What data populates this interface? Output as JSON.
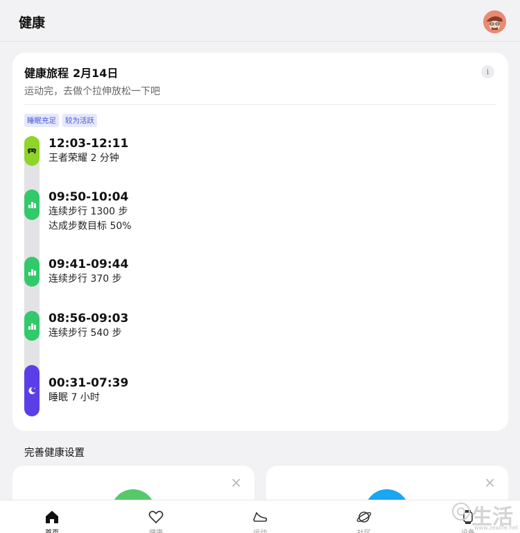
{
  "header": {
    "title": "健康",
    "avatar_icon": "user-avatar"
  },
  "journey": {
    "title": "健康旅程",
    "date": "2月14日",
    "subtitle": "运动完，去做个拉伸放松一下吧",
    "info_label": "i",
    "tags": [
      "睡眠充足",
      "较为活跃"
    ],
    "entries": [
      {
        "time": "12:03-12:11",
        "lines": [
          "王者荣耀 2 分钟"
        ],
        "icon": "gamepad-icon",
        "color": "#8ed42a"
      },
      {
        "time": "09:50-10:04",
        "lines": [
          "连续步行 1300 步",
          "达成步数目标 50%"
        ],
        "icon": "bar-chart-icon",
        "color": "#32c96b"
      },
      {
        "time": "09:41-09:44",
        "lines": [
          "连续步行 370 步"
        ],
        "icon": "bar-chart-icon",
        "color": "#32c96b"
      },
      {
        "time": "08:56-09:03",
        "lines": [
          "连续步行 540 步"
        ],
        "icon": "bar-chart-icon",
        "color": "#32c96b"
      },
      {
        "time": "00:31-07:39",
        "lines": [
          "睡眠 7 小时"
        ],
        "icon": "moon-icon",
        "color": "#5b3fe6"
      }
    ]
  },
  "settings_section": {
    "title": "完善健康设置",
    "cards": [
      {
        "close_label": "×",
        "accent": "#57c96a"
      },
      {
        "close_label": "×",
        "accent": "#1aa6f0"
      }
    ]
  },
  "tabbar": {
    "items": [
      {
        "label": "首页",
        "icon": "home-icon",
        "active": true
      },
      {
        "label": "健康",
        "icon": "heart-icon",
        "active": false
      },
      {
        "label": "运动",
        "icon": "shoe-icon",
        "active": false
      },
      {
        "label": "社区",
        "icon": "planet-icon",
        "active": false
      },
      {
        "label": "设备",
        "icon": "watch-icon",
        "active": false
      }
    ]
  },
  "watermark": {
    "big": "生活",
    "small": "www.zealife.net"
  }
}
